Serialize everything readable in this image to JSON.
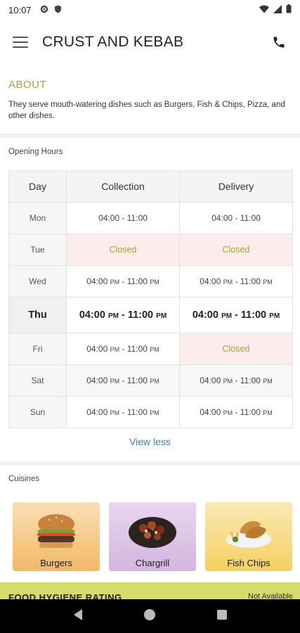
{
  "status_bar": {
    "time": "10:07"
  },
  "app_bar": {
    "title": "CRUST AND KEBAB"
  },
  "about": {
    "heading": "ABOUT",
    "text": "They serve mouth-watering dishes such as Burgers, Fish & Chips, Pizza, and other dishes."
  },
  "opening_hours": {
    "label": "Opening Hours",
    "headers": [
      "Day",
      "Collection",
      "Delivery"
    ],
    "closed_text": "Closed",
    "rows": [
      {
        "day": "Mon",
        "collection": "04:00      - 11:00",
        "delivery": "04:00      - 11:00"
      },
      {
        "day": "Tue",
        "collection": "Closed",
        "delivery": "Closed"
      },
      {
        "day": "Wed",
        "collection": "04:00 PM - 11:00 PM",
        "delivery": "04:00 PM - 11:00 PM"
      },
      {
        "day": "Thu",
        "collection": "04:00 PM - 11:00 PM",
        "delivery": "04:00 PM - 11:00 PM"
      },
      {
        "day": "Fri",
        "collection": "04:00 PM - 11:00 PM",
        "delivery": "Closed"
      },
      {
        "day": "Sat",
        "collection": "04:00 PM - 11:00 PM",
        "delivery": "04:00 PM - 11:00 PM"
      },
      {
        "day": "Sun",
        "collection": "04:00 PM - 11:00 PM",
        "delivery": "04:00 PM - 11:00 PM"
      }
    ],
    "view_less": "View less"
  },
  "cuisines": {
    "label": "Cuisines",
    "items": [
      {
        "label": "Burgers",
        "icon": "burger-icon"
      },
      {
        "label": "Chargrill",
        "icon": "chargrill-icon"
      },
      {
        "label": "Fish  Chips",
        "icon": "fish-chips-icon"
      }
    ]
  },
  "hygiene": {
    "title": "FOOD HYGIENE RATING",
    "status": "Not Available"
  },
  "colors": {
    "accent": "#b59a3e",
    "link": "#3a84b0",
    "closed_bg": "#fcecec",
    "hygiene_bg": "#d5dc6c"
  }
}
